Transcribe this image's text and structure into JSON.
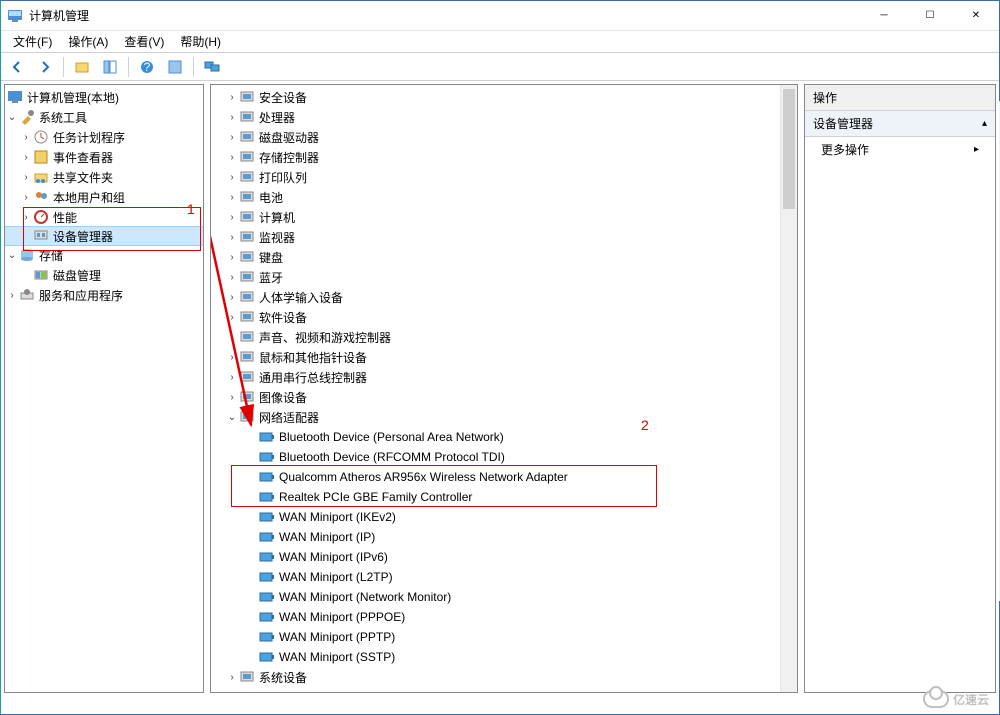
{
  "window": {
    "title": "计算机管理"
  },
  "menu": {
    "file": "文件(F)",
    "action": "操作(A)",
    "view": "查看(V)",
    "help": "帮助(H)"
  },
  "toolbar_icons": [
    "back-icon",
    "forward-icon",
    "up-icon",
    "show-hide-tree-icon",
    "properties-icon",
    "help-icon",
    "refresh-icon",
    "monitors-icon"
  ],
  "left_tree": {
    "root": "计算机管理(本地)",
    "system_tools": {
      "label": "系统工具",
      "children": {
        "task_scheduler": "任务计划程序",
        "event_viewer": "事件查看器",
        "shared_folders": "共享文件夹",
        "local_users": "本地用户和组",
        "performance": "性能",
        "device_manager": "设备管理器"
      }
    },
    "storage": {
      "label": "存储",
      "children": {
        "disk_mgmt": "磁盘管理"
      }
    },
    "services_apps": "服务和应用程序"
  },
  "device_tree": [
    {
      "label": "安全设备",
      "exp": ">"
    },
    {
      "label": "处理器",
      "exp": ">"
    },
    {
      "label": "磁盘驱动器",
      "exp": ">"
    },
    {
      "label": "存储控制器",
      "exp": ">"
    },
    {
      "label": "打印队列",
      "exp": ">"
    },
    {
      "label": "电池",
      "exp": ">"
    },
    {
      "label": "计算机",
      "exp": ">"
    },
    {
      "label": "监视器",
      "exp": ">"
    },
    {
      "label": "键盘",
      "exp": ">"
    },
    {
      "label": "蓝牙",
      "exp": ">"
    },
    {
      "label": "人体学输入设备",
      "exp": ">"
    },
    {
      "label": "软件设备",
      "exp": ">"
    },
    {
      "label": "声音、视频和游戏控制器",
      "exp": ">"
    },
    {
      "label": "鼠标和其他指针设备",
      "exp": ">"
    },
    {
      "label": "通用串行总线控制器",
      "exp": ">"
    },
    {
      "label": "图像设备",
      "exp": ">"
    },
    {
      "label": "网络适配器",
      "exp": "v",
      "children": [
        "Bluetooth Device (Personal Area Network)",
        "Bluetooth Device (RFCOMM Protocol TDI)",
        "Qualcomm Atheros AR956x Wireless Network Adapter",
        "Realtek PCIe GBE Family Controller",
        "WAN Miniport (IKEv2)",
        "WAN Miniport (IP)",
        "WAN Miniport (IPv6)",
        "WAN Miniport (L2TP)",
        "WAN Miniport (Network Monitor)",
        "WAN Miniport (PPPOE)",
        "WAN Miniport (PPTP)",
        "WAN Miniport (SSTP)"
      ]
    },
    {
      "label": "系统设备",
      "exp": ">"
    }
  ],
  "actions_pane": {
    "header": "操作",
    "group": "设备管理器",
    "more": "更多操作"
  },
  "annotations": {
    "one": "1",
    "two": "2"
  },
  "watermark": "亿速云"
}
